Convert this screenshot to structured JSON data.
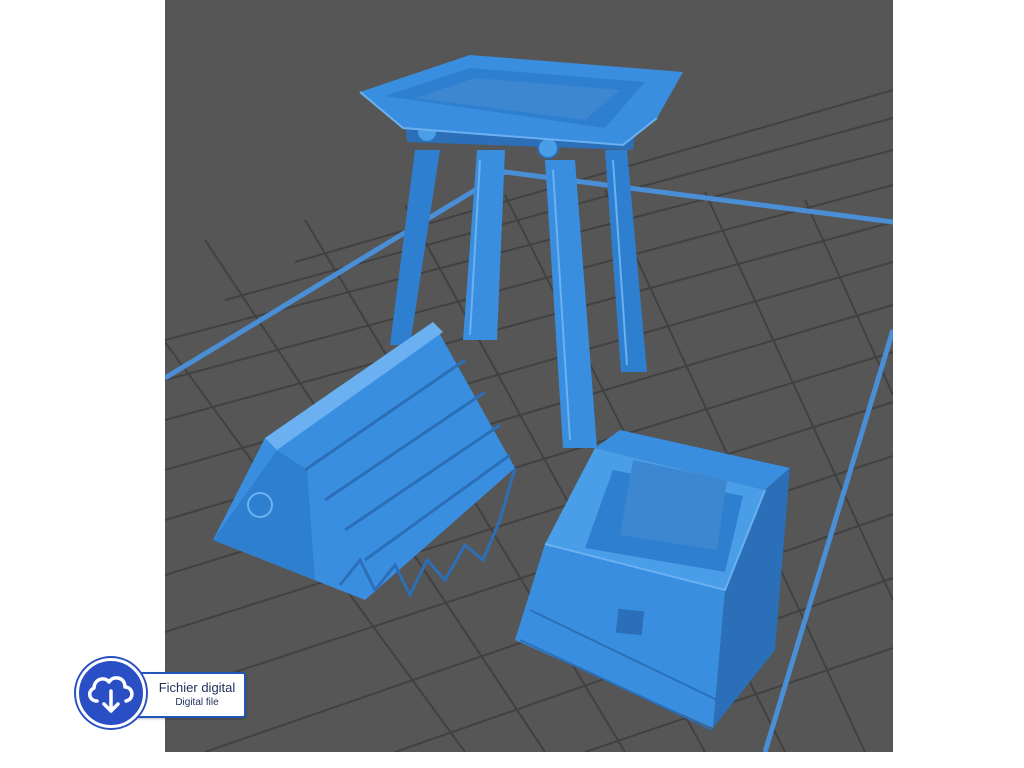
{
  "badge": {
    "line1": "Fichier digital",
    "line2": "Digital file",
    "icon": "cloud-download-icon"
  },
  "colors": {
    "background": "#ffffff",
    "viewport": "#555555",
    "grid_line": "#3f3f3f",
    "grid_border": "#4a8fd6",
    "model": "#3a8ee0",
    "model_shadow": "#2a6fb8",
    "model_highlight": "#6bb0f0",
    "badge_blue": "#2a4fc4"
  }
}
